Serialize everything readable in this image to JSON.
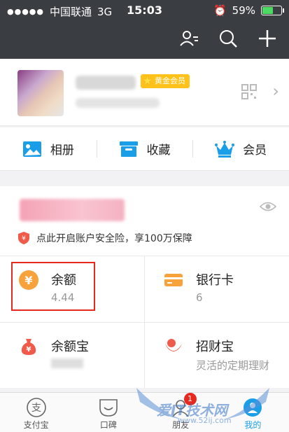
{
  "status_bar": {
    "carrier": "中国联通",
    "network": "3G",
    "time": "15:03",
    "battery": "59%",
    "battery_level": 0.59
  },
  "header": {
    "icons": [
      "contacts-icon",
      "search-icon",
      "add-icon"
    ]
  },
  "profile": {
    "badge": "黄金会员",
    "qr_icon": "qr-code-icon"
  },
  "shortcuts": [
    {
      "label": "相册",
      "icon": "photo-album-icon"
    },
    {
      "label": "收藏",
      "icon": "favorites-icon"
    },
    {
      "label": "会员",
      "icon": "crown-icon"
    }
  ],
  "assets": {
    "insurance_text": "点此开启账户安全险，享100万保障"
  },
  "grid": {
    "balance": {
      "title": "余额",
      "value": "4.44"
    },
    "bank_card": {
      "title": "银行卡",
      "value": "6"
    },
    "yuebao": {
      "title": "余额宝"
    },
    "zhaocaibao": {
      "title": "招财宝",
      "subtitle": "灵活的定期理财"
    }
  },
  "tabbar": [
    {
      "label": "支付宝",
      "icon": "alipay-icon"
    },
    {
      "label": "口碑",
      "icon": "koubei-icon"
    },
    {
      "label": "朋友",
      "icon": "friends-icon",
      "badge": "1"
    },
    {
      "label": "我的",
      "icon": "me-icon"
    }
  ],
  "watermark": {
    "text": "爱IT技术网",
    "url": "www.52ij.com"
  },
  "colors": {
    "header_bg": "#3a3d42",
    "accent_blue": "#1a9ee8",
    "highlight_red": "#e8271f",
    "orange": "#f7a23b"
  }
}
